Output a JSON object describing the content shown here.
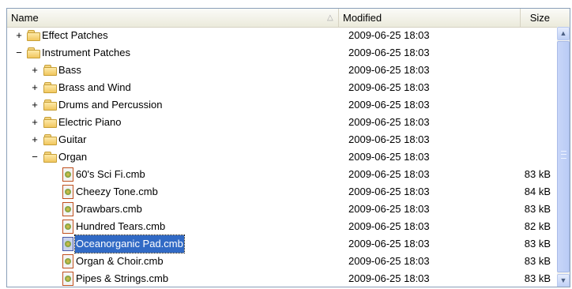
{
  "header": {
    "name": "Name",
    "modified": "Modified",
    "size": "Size",
    "sort_glyph": "△"
  },
  "expander": {
    "plus": "+",
    "minus": "−"
  },
  "rows": [
    {
      "label": "Effect Patches",
      "modified": "2009-06-25 18:03",
      "size": "",
      "type": "folder",
      "expander": "+",
      "level": 0
    },
    {
      "label": "Instrument Patches",
      "modified": "2009-06-25 18:03",
      "size": "",
      "type": "folder",
      "expander": "−",
      "level": 0
    },
    {
      "label": "Bass",
      "modified": "2009-06-25 18:03",
      "size": "",
      "type": "folder",
      "expander": "+",
      "level": 1
    },
    {
      "label": "Brass and Wind",
      "modified": "2009-06-25 18:03",
      "size": "",
      "type": "folder",
      "expander": "+",
      "level": 1
    },
    {
      "label": "Drums and Percussion",
      "modified": "2009-06-25 18:03",
      "size": "",
      "type": "folder",
      "expander": "+",
      "level": 1
    },
    {
      "label": "Electric Piano",
      "modified": "2009-06-25 18:03",
      "size": "",
      "type": "folder",
      "expander": "+",
      "level": 1
    },
    {
      "label": "Guitar",
      "modified": "2009-06-25 18:03",
      "size": "",
      "type": "folder",
      "expander": "+",
      "level": 1
    },
    {
      "label": "Organ",
      "modified": "2009-06-25 18:03",
      "size": "",
      "type": "folder",
      "expander": "−",
      "level": 1
    },
    {
      "label": "60's Sci Fi.cmb",
      "modified": "2009-06-25 18:03",
      "size": "83 kB",
      "type": "file",
      "expander": "",
      "level": 2
    },
    {
      "label": "Cheezy Tone.cmb",
      "modified": "2009-06-25 18:03",
      "size": "84 kB",
      "type": "file",
      "expander": "",
      "level": 2
    },
    {
      "label": "Drawbars.cmb",
      "modified": "2009-06-25 18:03",
      "size": "83 kB",
      "type": "file",
      "expander": "",
      "level": 2
    },
    {
      "label": "Hundred Tears.cmb",
      "modified": "2009-06-25 18:03",
      "size": "82 kB",
      "type": "file",
      "expander": "",
      "level": 2
    },
    {
      "label": "Oceanorganic Pad.cmb",
      "modified": "2009-06-25 18:03",
      "size": "83 kB",
      "type": "file",
      "expander": "",
      "level": 2,
      "selected": true
    },
    {
      "label": "Organ & Choir.cmb",
      "modified": "2009-06-25 18:03",
      "size": "83 kB",
      "type": "file",
      "expander": "",
      "level": 2
    },
    {
      "label": "Pipes & Strings.cmb",
      "modified": "2009-06-25 18:03",
      "size": "83 kB",
      "type": "file",
      "expander": "",
      "level": 2
    }
  ],
  "scrollbar": {
    "up_glyph": "▲",
    "down_glyph": "▼"
  },
  "icons": {
    "folder": "folder-icon",
    "file": "patch-file-icon"
  },
  "colors": {
    "selection": "#316ac5",
    "header_bg": "#ebeadb",
    "frame_border": "#8a9fb8"
  }
}
